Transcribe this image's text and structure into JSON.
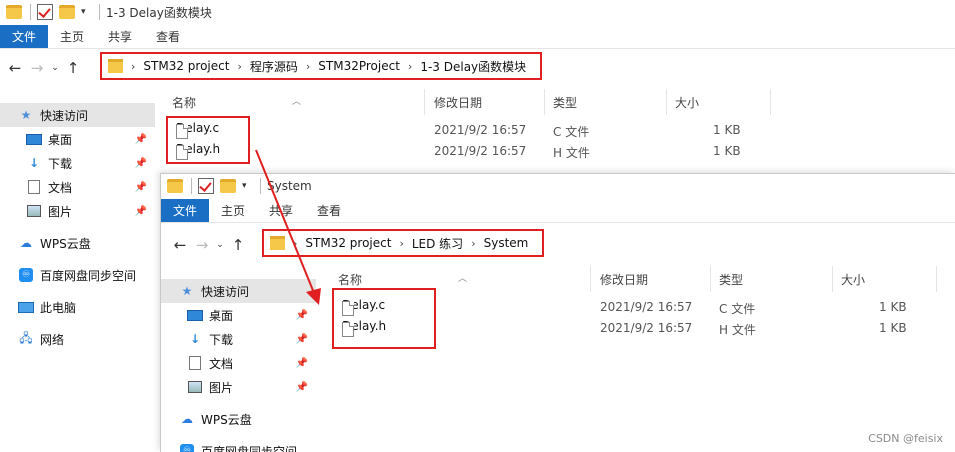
{
  "back_window": {
    "title": "1-3 Delay函数模块",
    "ribbon_tabs": [
      "文件",
      "主页",
      "共享",
      "查看"
    ],
    "breadcrumb": [
      "STM32 project",
      "程序源码",
      "STM32Project",
      "1-3 Delay函数模块"
    ],
    "nav": [
      {
        "label": "快速访问",
        "icon": "star-icon",
        "pinned": false,
        "selected": true
      },
      {
        "label": "桌面",
        "icon": "desktop-icon",
        "pinned": true
      },
      {
        "label": "下载",
        "icon": "download-arrow-icon",
        "pinned": true
      },
      {
        "label": "文档",
        "icon": "document-icon",
        "pinned": true
      },
      {
        "label": "图片",
        "icon": "pictures-icon",
        "pinned": true
      },
      {
        "label": "WPS云盘",
        "icon": "wps-cloud-icon"
      },
      {
        "label": "百度网盘同步空间",
        "icon": "baidu-netdisk-icon"
      },
      {
        "label": "此电脑",
        "icon": "this-pc-icon"
      },
      {
        "label": "网络",
        "icon": "network-icon"
      }
    ],
    "columns": [
      "名称",
      "修改日期",
      "类型",
      "大小"
    ],
    "files": [
      {
        "name": "Delay.c",
        "date": "2021/9/2 16:57",
        "type": "C 文件",
        "size": "1 KB"
      },
      {
        "name": "Delay.h",
        "date": "2021/9/2 16:57",
        "type": "H 文件",
        "size": "1 KB"
      }
    ]
  },
  "front_window": {
    "title": "System",
    "ribbon_tabs": [
      "文件",
      "主页",
      "共享",
      "查看"
    ],
    "breadcrumb": [
      "STM32 project",
      "LED 练习",
      "System"
    ],
    "nav": [
      {
        "label": "快速访问",
        "icon": "star-icon",
        "pinned": false,
        "selected": true
      },
      {
        "label": "桌面",
        "icon": "desktop-icon",
        "pinned": true
      },
      {
        "label": "下载",
        "icon": "download-arrow-icon",
        "pinned": true
      },
      {
        "label": "文档",
        "icon": "document-icon",
        "pinned": true
      },
      {
        "label": "图片",
        "icon": "pictures-icon",
        "pinned": true
      },
      {
        "label": "WPS云盘",
        "icon": "wps-cloud-icon"
      },
      {
        "label": "百度网盘同步空间",
        "icon": "baidu-netdisk-icon"
      }
    ],
    "columns": [
      "名称",
      "修改日期",
      "类型",
      "大小"
    ],
    "files": [
      {
        "name": "Delay.c",
        "date": "2021/9/2 16:57",
        "type": "C 文件",
        "size": "1 KB"
      },
      {
        "name": "Delay.h",
        "date": "2021/9/2 16:57",
        "type": "H 文件",
        "size": "1 KB"
      }
    ]
  },
  "watermark": "CSDN @feisix",
  "colors": {
    "ribbon_file_tab": "#1a6fc4",
    "highlight_red": "#e02020",
    "folder_yellow": "#f5c84a"
  }
}
